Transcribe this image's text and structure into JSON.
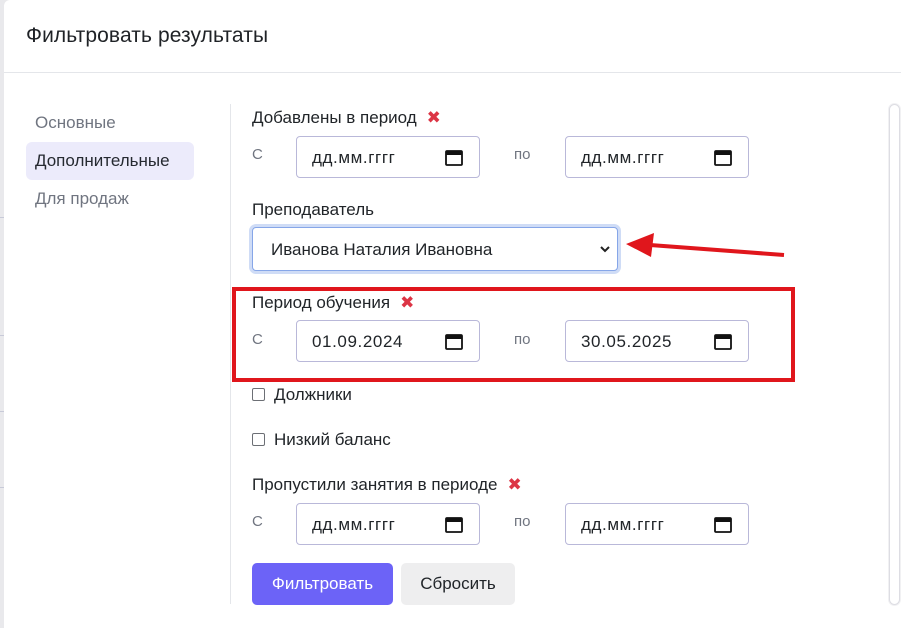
{
  "modal": {
    "title": "Фильтровать результаты"
  },
  "sidebar": {
    "items": [
      {
        "label": "Основные"
      },
      {
        "label": "Дополнительные",
        "active": true
      },
      {
        "label": "Для продаж"
      }
    ]
  },
  "filters": {
    "added_period": {
      "label": "Добавлены в период",
      "from_label": "С",
      "to_label": "по",
      "from_value": "дд.мм.гггг",
      "to_value": "дд.мм.гггг"
    },
    "teacher": {
      "label": "Преподаватель",
      "selected": "Иванова Наталия Ивановна"
    },
    "study_period": {
      "label": "Период обучения",
      "from_label": "С",
      "to_label": "по",
      "from_value": "01.09.2024",
      "to_value": "30.05.2025"
    },
    "debtors": {
      "label": "Должники",
      "checked": false
    },
    "low_balance": {
      "label": "Низкий баланс",
      "checked": false
    },
    "missed_period": {
      "label": "Пропустили занятия в периоде",
      "from_label": "С",
      "to_label": "по",
      "from_value": "дд.мм.гггг",
      "to_value": "дд.мм.гггг"
    }
  },
  "actions": {
    "apply": "Фильтровать",
    "reset": "Сбросить"
  },
  "annotations": {
    "highlight_color": "#e0161c",
    "accent": "#6c63f7"
  },
  "icons": {
    "clear": "close-icon",
    "date": "calendar-icon",
    "select": "chevron-down-icon"
  }
}
